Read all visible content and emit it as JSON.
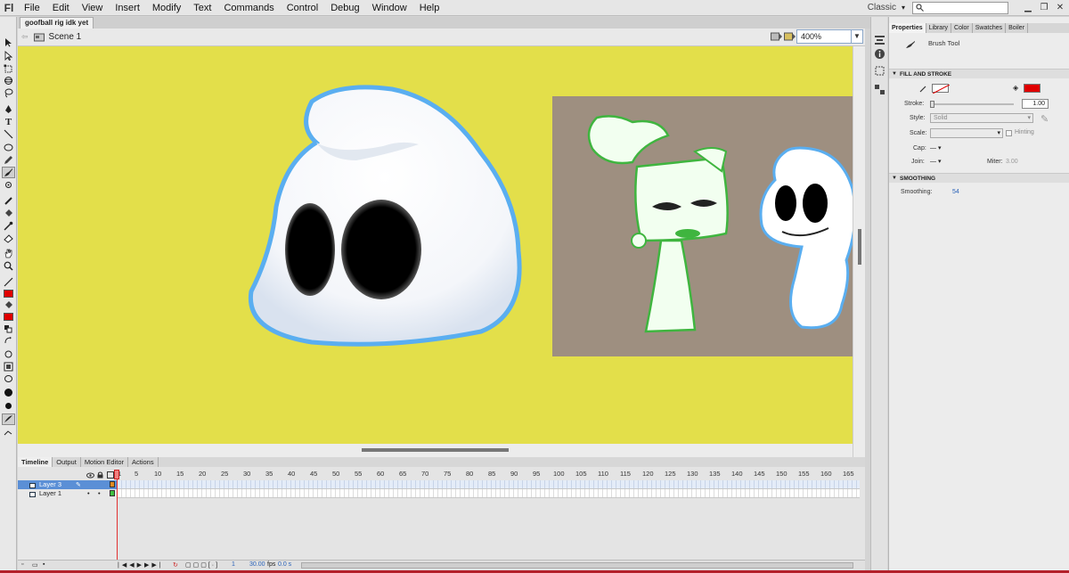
{
  "app": {
    "logo": "Fl",
    "menu": [
      "File",
      "Edit",
      "View",
      "Insert",
      "Modify",
      "Text",
      "Commands",
      "Control",
      "Debug",
      "Window",
      "Help"
    ],
    "workspace": "Classic"
  },
  "document": {
    "tab_title": "goofball rig idk yet",
    "scene": "Scene 1",
    "zoom": "400%"
  },
  "timeline": {
    "tabs": [
      "Timeline",
      "Output",
      "Motion Editor",
      "Actions"
    ],
    "layers": [
      {
        "name": "Layer 3",
        "selected": true
      },
      {
        "name": "Layer 1",
        "selected": false
      }
    ],
    "ticks": [
      "1",
      "5",
      "10",
      "15",
      "20",
      "25",
      "30",
      "35",
      "40",
      "45",
      "50",
      "55",
      "60",
      "65",
      "70",
      "75",
      "80",
      "85",
      "90",
      "95",
      "100",
      "105",
      "110",
      "115",
      "120",
      "125",
      "130",
      "135",
      "140",
      "145",
      "150",
      "155",
      "160",
      "165"
    ],
    "footer": {
      "frame": "1",
      "fps": "30.00",
      "fps_unit": "fps",
      "time": "0.0 s"
    }
  },
  "properties": {
    "tabs": [
      "Properties",
      "Library",
      "Color",
      "Swatches",
      "Boiler"
    ],
    "tool_name": "Brush Tool",
    "fill_stroke_header": "FILL AND STROKE",
    "stroke_label": "Stroke:",
    "stroke_value": "1.00",
    "style_label": "Style:",
    "style_value": "Solid",
    "scale_label": "Scale:",
    "hinting_label": "Hinting",
    "cap_label": "Cap:",
    "join_label": "Join:",
    "miter_label": "Miter:",
    "miter_value": "3.00",
    "smoothing_header": "SMOOTHING",
    "smoothing_label": "Smoothing:",
    "smoothing_value": "54"
  },
  "colors": {
    "stage": "#e3df4a",
    "fill_color": "#e00000",
    "stroke_color": "#e00000",
    "ref_bg": "#9e8f80",
    "ghost_outline": "#5aaef0",
    "green_outline": "#3fb53f"
  }
}
